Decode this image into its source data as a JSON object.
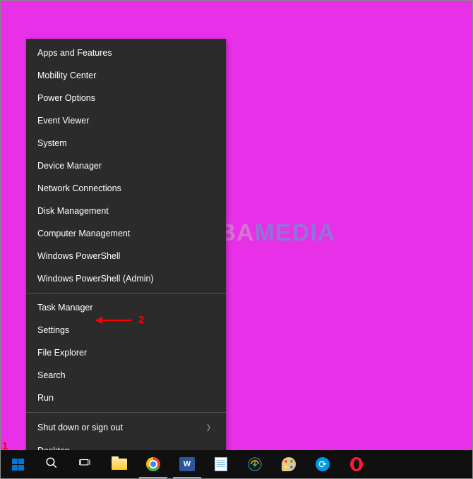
{
  "watermark": {
    "part1": "NESABA",
    "part2": "MEDIA"
  },
  "annotations": {
    "label1": "1",
    "label2": "2"
  },
  "contextMenu": {
    "group1": [
      "Apps and Features",
      "Mobility Center",
      "Power Options",
      "Event Viewer",
      "System",
      "Device Manager",
      "Network Connections",
      "Disk Management",
      "Computer Management",
      "Windows PowerShell",
      "Windows PowerShell (Admin)"
    ],
    "group2": [
      "Task Manager",
      "Settings",
      "File Explorer",
      "Search",
      "Run"
    ],
    "group3": {
      "shutdown": "Shut down or sign out",
      "desktop": "Desktop"
    }
  },
  "taskbar": {
    "wordBadge": "W"
  }
}
